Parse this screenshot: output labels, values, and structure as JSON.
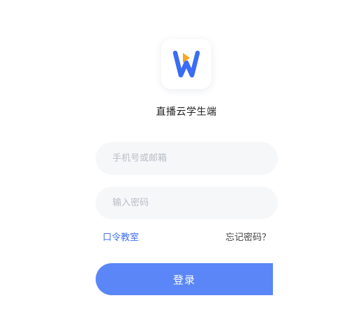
{
  "app": {
    "title": "直播云学生端",
    "logo_icon": "w-logo-icon"
  },
  "form": {
    "phone_placeholder": "手机号或邮箱",
    "phone_value": "",
    "password_placeholder": "输入密码",
    "password_value": ""
  },
  "links": {
    "classroom": "口令教室",
    "forgot_password": "忘记密码？"
  },
  "actions": {
    "login_label": "登录"
  },
  "colors": {
    "primary": "#5a86f7",
    "link": "#3f6ff0",
    "logo_blue": "#3a6cf4",
    "logo_orange": "#f6a623",
    "field_bg": "#f6f7f9"
  }
}
